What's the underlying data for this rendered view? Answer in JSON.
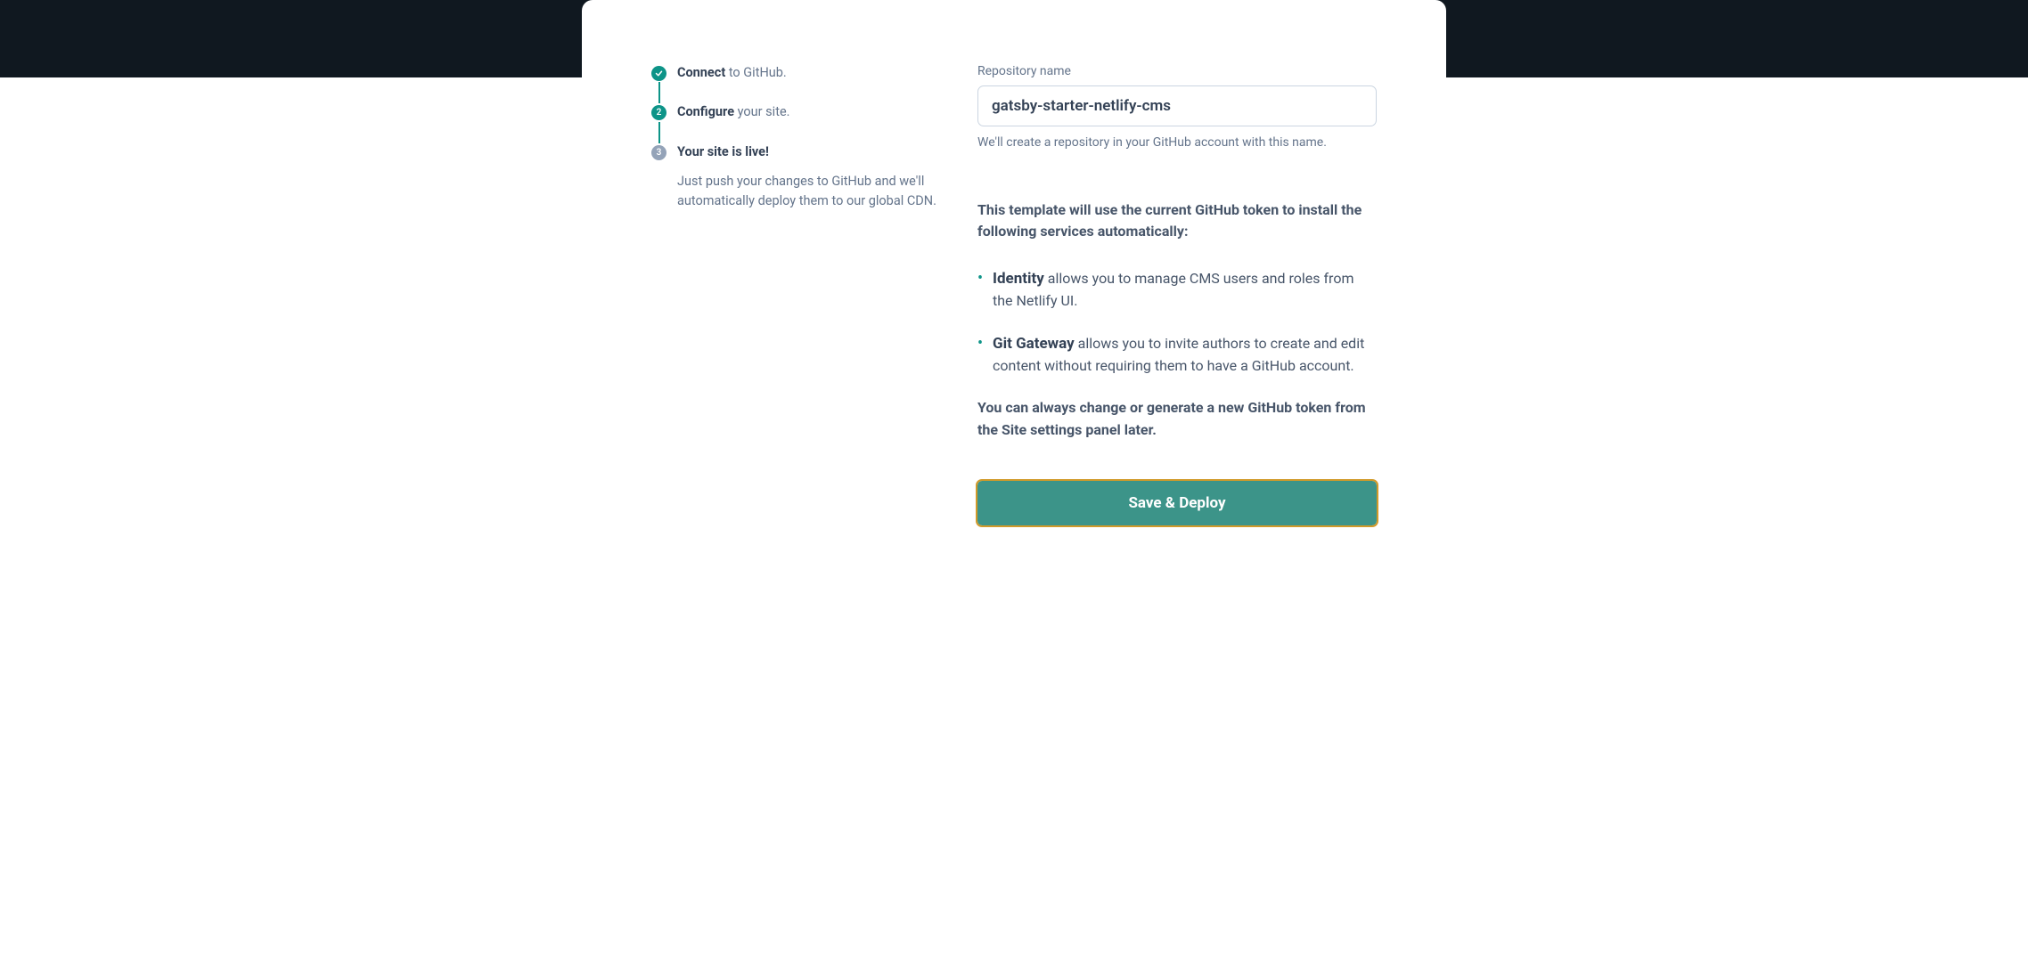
{
  "steps": {
    "step1": {
      "bold": "Connect",
      "rest": " to GitHub."
    },
    "step2": {
      "bold": "Configure",
      "rest": " your site.",
      "number": "2"
    },
    "step3": {
      "bold": "Your site is live!",
      "number": "3"
    }
  },
  "helper": "Just push your changes to GitHub and we'll automatically deploy them to our global CDN.",
  "form": {
    "repo_label": "Repository name",
    "repo_value": "gatsby-starter-netlify-cms",
    "repo_hint": "We'll create a repository in your GitHub account with this name."
  },
  "intro": "This template will use the current GitHub token to install the following services automatically:",
  "services": [
    {
      "name": "Identity",
      "desc": " allows you to manage CMS users and roles from the Netlify UI."
    },
    {
      "name": "Git Gateway",
      "desc": " allows you to invite authors to create and edit content without requiring them to have a GitHub account."
    }
  ],
  "footer": "You can always change or generate a new GitHub token from the Site settings panel later.",
  "deploy_label": "Save & Deploy"
}
